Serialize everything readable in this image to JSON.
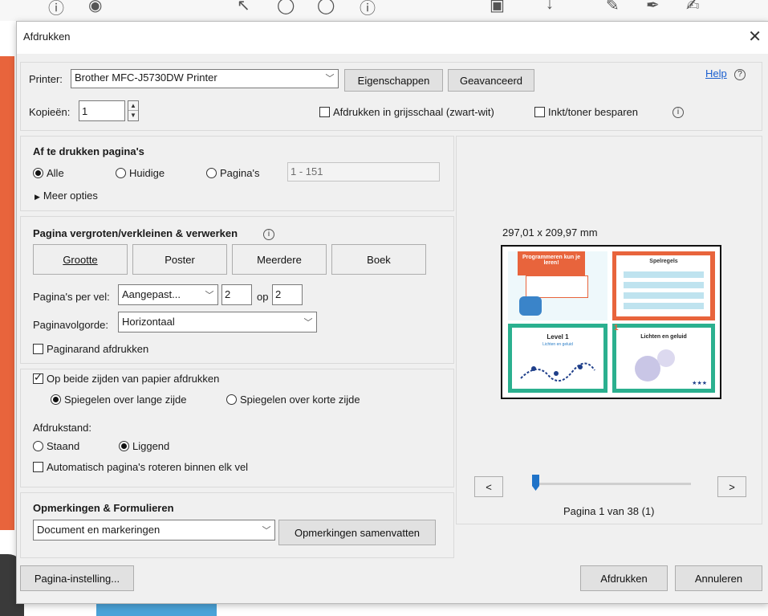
{
  "dialog": {
    "title": "Afdrukken",
    "close_icon": "close-icon"
  },
  "printer": {
    "label": "Printer:",
    "selected": "Brother MFC-J5730DW Printer",
    "properties_button": "Eigenschappen",
    "advanced_button": "Geavanceerd",
    "help_link": "Help",
    "copies_label": "Kopieën:",
    "copies_value": "1",
    "grayscale_label": "Afdrukken in grijsschaal (zwart-wit)",
    "grayscale_checked": false,
    "save_ink_label": "Inkt/toner besparen",
    "save_ink_checked": false
  },
  "pages": {
    "heading": "Af te drukken pagina's",
    "option_all": "Alle",
    "option_current": "Huidige",
    "option_pages": "Pagina's",
    "selected": "all",
    "range_value": "1 - 151",
    "more_options": "Meer opties"
  },
  "scaling": {
    "heading": "Pagina vergroten/verkleinen & verwerken",
    "buttons": [
      "Grootte",
      "Poster",
      "Meerdere",
      "Boek"
    ],
    "pages_per_sheet_label": "Pagina's per vel:",
    "pages_per_sheet_value": "Aangepast...",
    "cols": "2",
    "op_label": "op",
    "rows": "2",
    "order_label": "Paginavolgorde:",
    "order_value": "Horizontaal",
    "border_label": "Paginarand afdrukken",
    "border_checked": false
  },
  "duplex": {
    "both_sides_label": "Op beide zijden van papier afdrukken",
    "both_sides_checked": true,
    "long_edge_label": "Spiegelen over lange zijde",
    "short_edge_label": "Spiegelen over korte zijde",
    "flip_selected": "long",
    "orientation_label": "Afdrukstand:",
    "portrait_label": "Staand",
    "landscape_label": "Liggend",
    "orientation_selected": "landscape",
    "auto_rotate_label": "Automatisch pagina's roteren binnen elk vel",
    "auto_rotate_checked": false
  },
  "comments": {
    "heading": "Opmerkingen & Formulieren",
    "selected": "Document en markeringen",
    "summarize_button": "Opmerkingen samenvatten"
  },
  "preview": {
    "size_text": "297,01 x 209,97 mm",
    "prev_label": "<",
    "next_label": ">",
    "page_status": "Pagina 1 van 38 (1)",
    "slider_position": 0.0,
    "thumbs": {
      "card1_title": "Programmeren kun je leren!",
      "card2_title": "Spelregels",
      "card3_title": "Level 1",
      "card3_subtitle": "Lichten en geluid",
      "card4_number": "1",
      "card4_title": "Lichten en geluid",
      "card4_stars": "★★★"
    }
  },
  "footer": {
    "page_setup_button": "Pagina-instelling...",
    "print_button": "Afdrukken",
    "cancel_button": "Annuleren"
  },
  "colors": {
    "accent_orange": "#e8643c",
    "teal_border": "#2bb08f",
    "slider_blue": "#1f73c8"
  }
}
